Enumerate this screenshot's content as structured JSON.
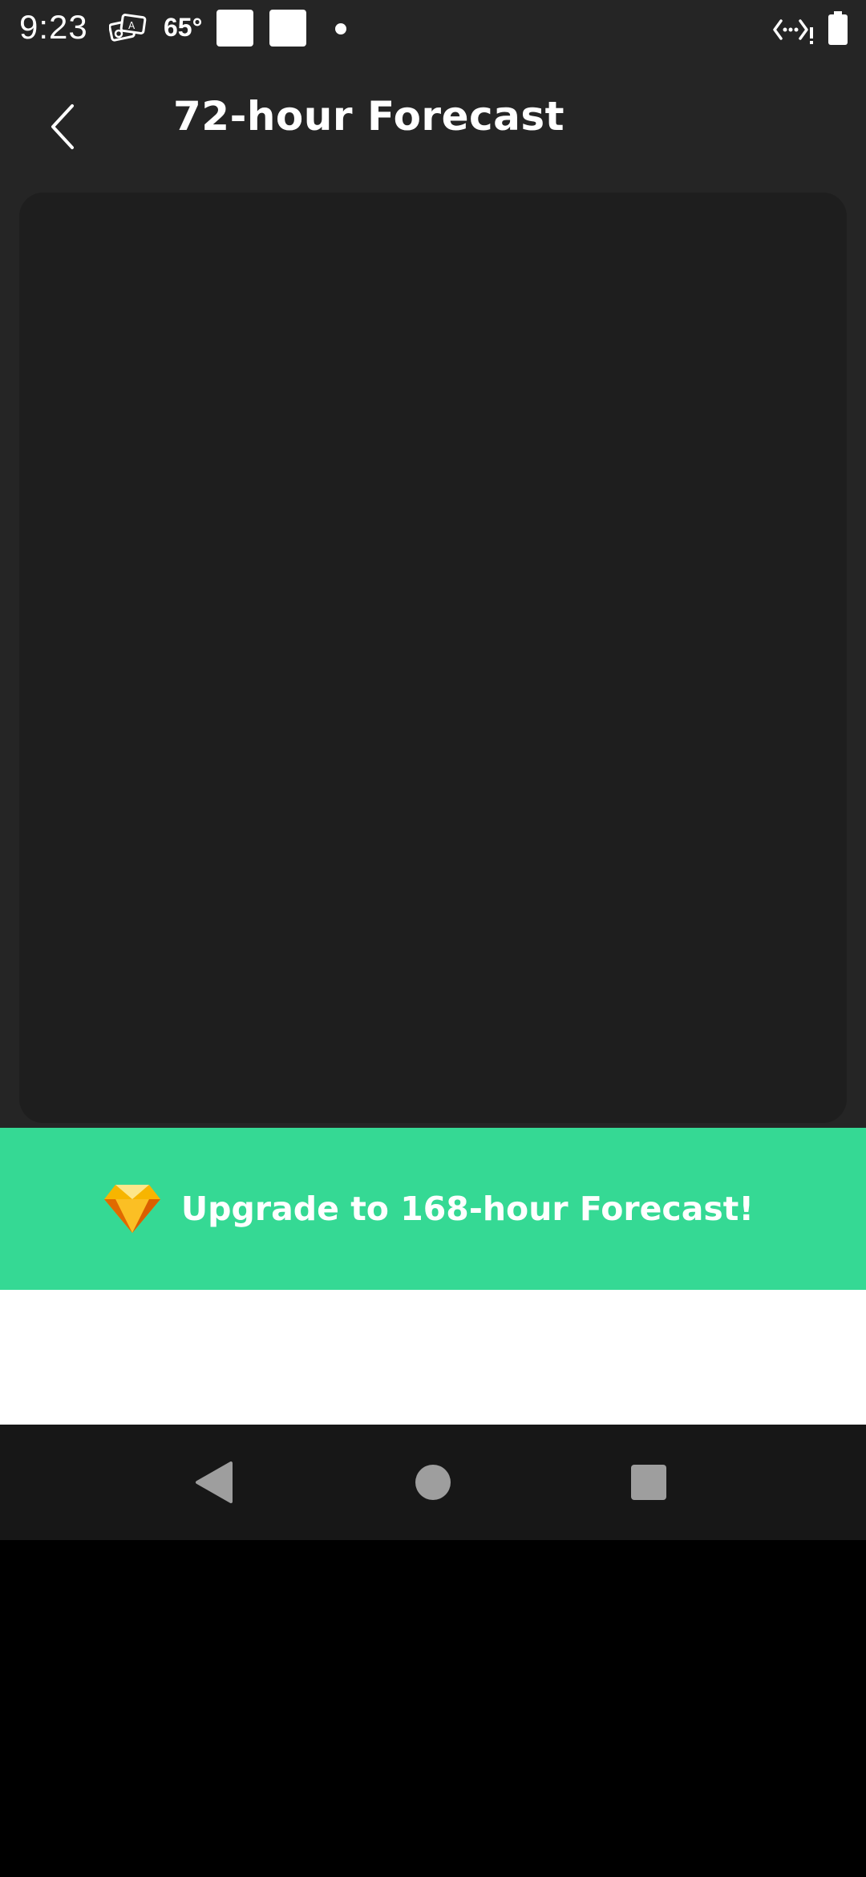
{
  "status_bar": {
    "time": "9:23",
    "temperature": "65°",
    "icons": [
      "photos-icon",
      "notification-square-icon",
      "notification-square-icon",
      "dot-icon",
      "network-icon",
      "battery-icon"
    ]
  },
  "header": {
    "title": "72-hour Forecast",
    "back_icon": "chevron-left-icon"
  },
  "banner": {
    "label": "Upgrade to 168-hour Forecast!",
    "icon": "diamond-icon"
  },
  "nav": {
    "icons": [
      "back-triangle-icon",
      "home-circle-icon",
      "recents-square-icon"
    ]
  },
  "colors": {
    "background": "#252525",
    "panel": "#1e1e1e",
    "accent": "#35d994",
    "nav": "#171717"
  }
}
